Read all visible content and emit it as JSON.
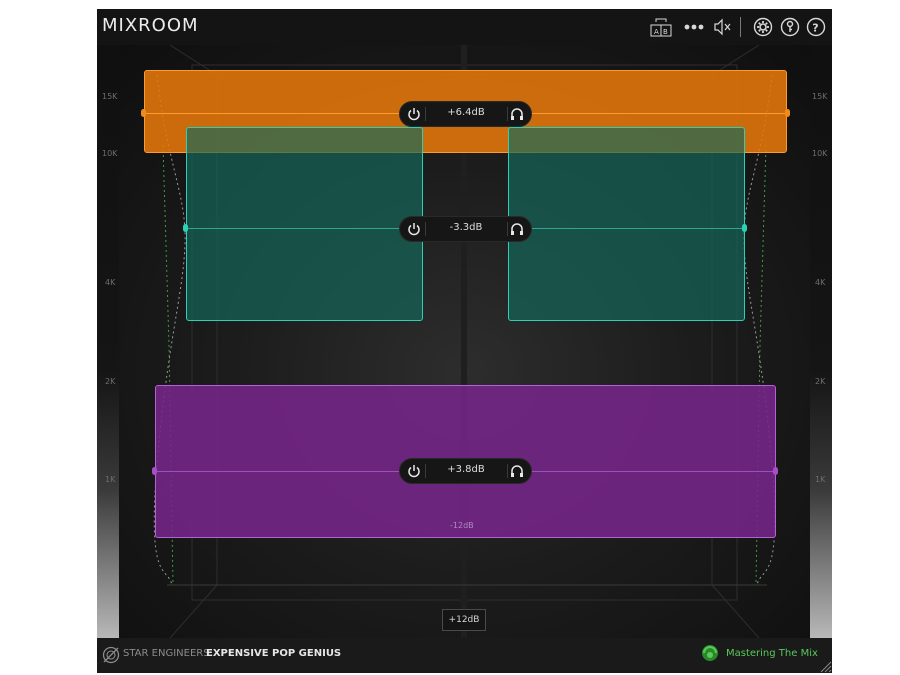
{
  "app": {
    "title": "MIXROOM"
  },
  "toolbar": {
    "ab_label": "A B",
    "more_label": "•••",
    "icons": [
      "ab-compare-icon",
      "more-icon",
      "mute-icon",
      "settings-icon",
      "key-icon",
      "help-icon"
    ]
  },
  "axis": {
    "freq_ticks": [
      "15K",
      "10K",
      "4K",
      "2K",
      "1K"
    ],
    "right_ticks": [
      "15K",
      "10K",
      "4K",
      "2K",
      "1K"
    ]
  },
  "bands": [
    {
      "name": "high",
      "gain": "+6.4dB",
      "color": "#f08a1a"
    },
    {
      "name": "mid",
      "gain": "-3.3dB",
      "color": "#2fcfb6"
    },
    {
      "name": "low",
      "gain": "+3.8dB",
      "color": "#a64ec8"
    }
  ],
  "footer": {
    "company": "STAR ENGINEERS",
    "product": "EXPENSIVE POP GENIUS",
    "partner": "Mastering The Mix"
  },
  "bottom_readout": "+12dB",
  "band_label_bottom": "-12dB"
}
